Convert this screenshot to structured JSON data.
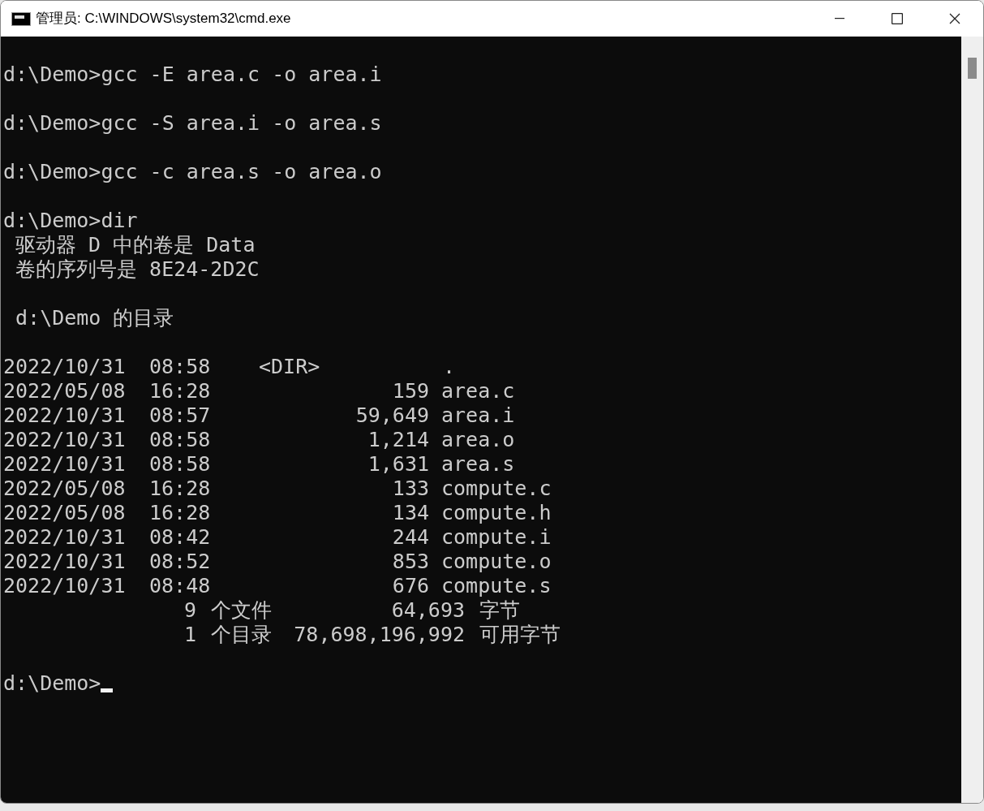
{
  "window": {
    "title": "管理员: C:\\WINDOWS\\system32\\cmd.exe"
  },
  "console": {
    "blocks": [
      [
        "d:\\Demo>gcc -E area.c -o area.i"
      ],
      [
        "d:\\Demo>gcc -S area.i -o area.s"
      ],
      [
        "d:\\Demo>gcc -c area.s -o area.o"
      ],
      [
        "d:\\Demo>dir",
        " 驱动器 D 中的卷是 Data",
        " 卷的序列号是 8E24-2D2C"
      ],
      [
        " d:\\Demo 的目录"
      ]
    ],
    "listing": [
      {
        "kind": "dir",
        "date": "2022/10/31",
        "time": "08:58",
        "size": "<DIR>",
        "name": "."
      },
      {
        "kind": "file",
        "date": "2022/05/08",
        "time": "16:28",
        "size": "159",
        "name": "area.c"
      },
      {
        "kind": "file",
        "date": "2022/10/31",
        "time": "08:57",
        "size": "59,649",
        "name": "area.i"
      },
      {
        "kind": "file",
        "date": "2022/10/31",
        "time": "08:58",
        "size": "1,214",
        "name": "area.o"
      },
      {
        "kind": "file",
        "date": "2022/10/31",
        "time": "08:58",
        "size": "1,631",
        "name": "area.s"
      },
      {
        "kind": "file",
        "date": "2022/05/08",
        "time": "16:28",
        "size": "133",
        "name": "compute.c"
      },
      {
        "kind": "file",
        "date": "2022/05/08",
        "time": "16:28",
        "size": "134",
        "name": "compute.h"
      },
      {
        "kind": "file",
        "date": "2022/10/31",
        "time": "08:42",
        "size": "244",
        "name": "compute.i"
      },
      {
        "kind": "file",
        "date": "2022/10/31",
        "time": "08:52",
        "size": "853",
        "name": "compute.o"
      },
      {
        "kind": "file",
        "date": "2022/10/31",
        "time": "08:48",
        "size": "676",
        "name": "compute.s"
      }
    ],
    "summary": [
      {
        "count": "9",
        "label": "个文件",
        "bytes": "64,693",
        "unit": "字节"
      },
      {
        "count": "1",
        "label": "个目录",
        "bytes": "78,698,196,992",
        "unit": "可用字节"
      }
    ],
    "prompt": "d:\\Demo>",
    "cursor": {
      "visible": true
    }
  }
}
